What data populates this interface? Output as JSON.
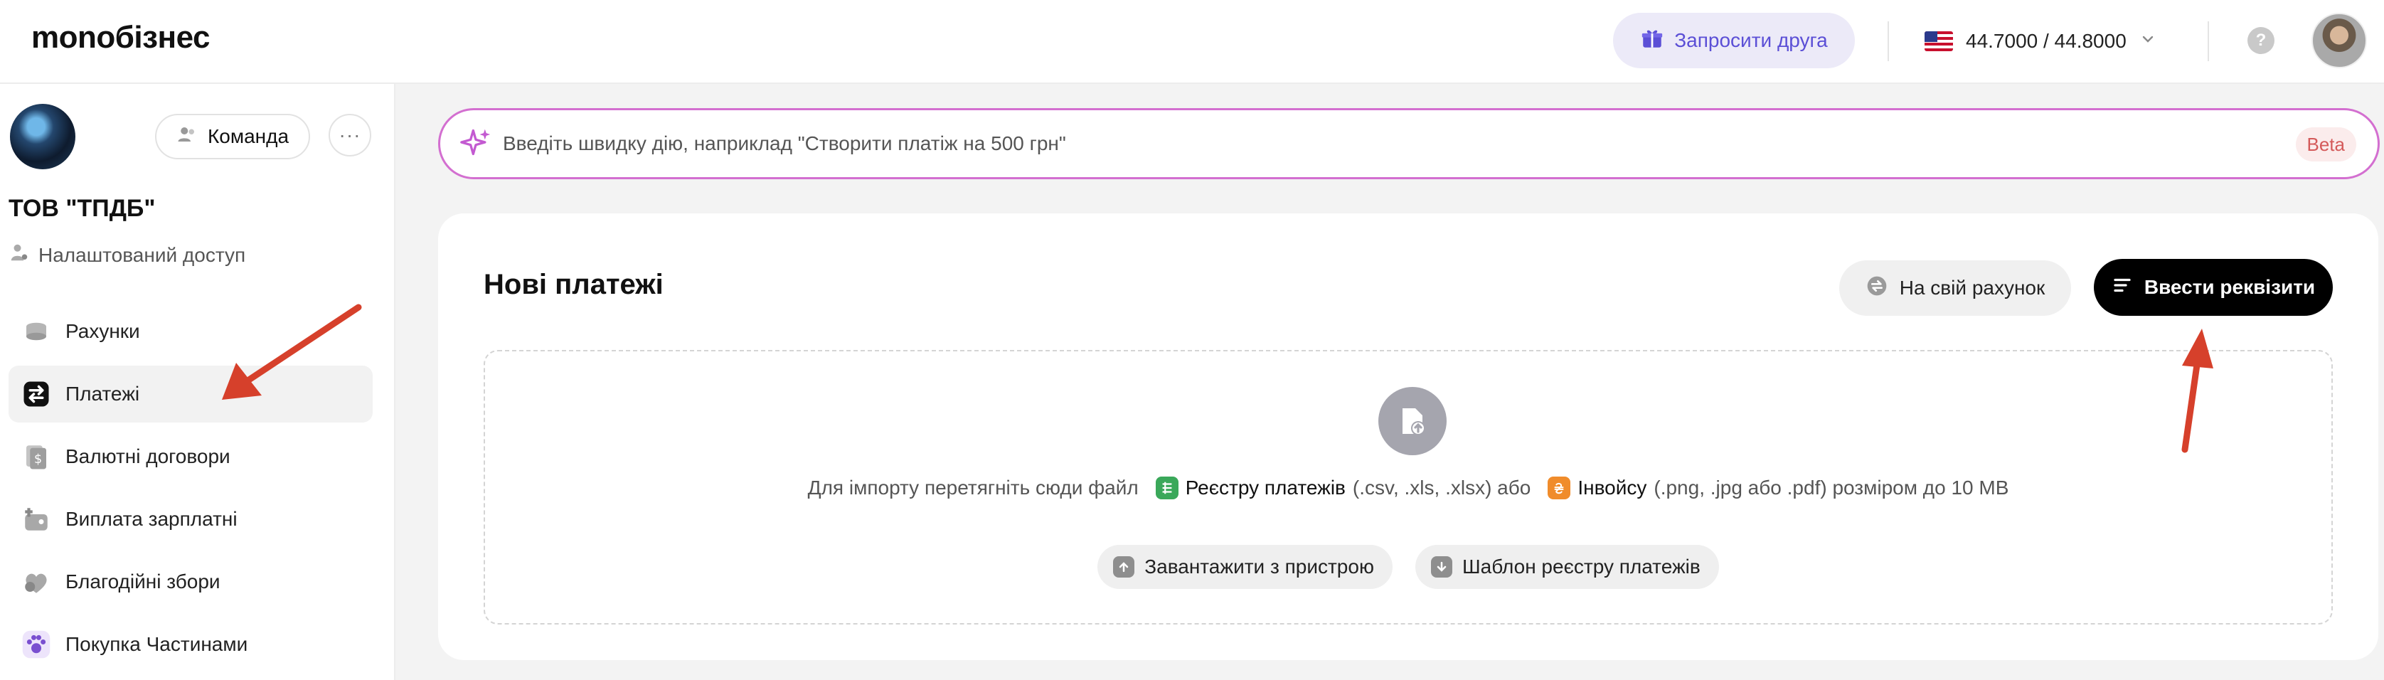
{
  "header": {
    "logo": "monoбізнес",
    "invite_label": "Запросити друга",
    "rate": "44.7000 / 44.8000",
    "help": "?"
  },
  "sidebar": {
    "team_label": "Команда",
    "more": "···",
    "company_name": "ТОВ \"ТПДБ\"",
    "access_label": "Налаштований доступ",
    "items": [
      {
        "label": "Рахунки",
        "icon": "accounts-icon"
      },
      {
        "label": "Платежі",
        "icon": "payments-icon",
        "active": true
      },
      {
        "label": "Валютні договори",
        "icon": "currency-contracts-icon"
      },
      {
        "label": "Виплата зарплатні",
        "icon": "salary-icon"
      },
      {
        "label": "Благодійні збори",
        "icon": "charity-icon"
      },
      {
        "label": "Покупка Частинами",
        "icon": "installments-icon"
      }
    ]
  },
  "quick_action": {
    "placeholder": "Введіть швидку дію, наприклад \"Створити платіж на 500 грн\"",
    "beta": "Beta"
  },
  "payments_card": {
    "title": "Нові платежі",
    "own_account_label": "На свій рахунок",
    "enter_details_label": "Ввести реквізити",
    "drop": {
      "text_prefix": "Для імпорту перетягніть сюди файл",
      "registry_label": "Реєстру платежів",
      "registry_formats": "(.csv, .xls, .xlsx) або",
      "invoice_label": "Інвойсу",
      "invoice_formats": "(.png, .jpg або .pdf) розміром до 10 MB",
      "upload_label": "Завантажити з пристрою",
      "template_label": "Шаблон реєстру платежів"
    }
  },
  "colors": {
    "accent_purple": "#5b4fd6",
    "quick_border": "#d36fd0",
    "arrow_red": "#d6402b",
    "registry_green": "#3aa85a",
    "invoice_orange": "#f08c2b"
  }
}
